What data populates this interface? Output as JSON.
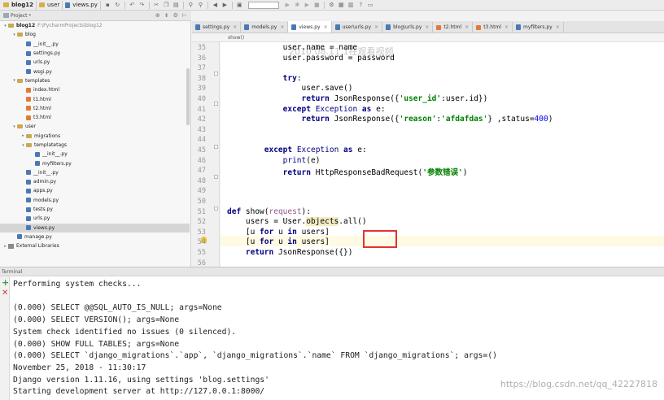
{
  "toolbar": {
    "breadcrumbs": [
      "blog12",
      "user",
      "views.py"
    ]
  },
  "project": {
    "title": "Project",
    "items": [
      {
        "label": "blog12",
        "path": "F:\\PycharmProjects\\blog12",
        "indent": 0,
        "kind": "folder",
        "arrow": "▾"
      },
      {
        "label": "blog",
        "indent": 1,
        "kind": "folder",
        "arrow": "▾"
      },
      {
        "label": "__init__.py",
        "indent": 2,
        "kind": "py"
      },
      {
        "label": "settings.py",
        "indent": 2,
        "kind": "py"
      },
      {
        "label": "urls.py",
        "indent": 2,
        "kind": "py"
      },
      {
        "label": "wsgi.py",
        "indent": 2,
        "kind": "py"
      },
      {
        "label": "templates",
        "indent": 1,
        "kind": "folder",
        "arrow": "▾"
      },
      {
        "label": "index.html",
        "indent": 2,
        "kind": "html"
      },
      {
        "label": "t1.html",
        "indent": 2,
        "kind": "html"
      },
      {
        "label": "t2.html",
        "indent": 2,
        "kind": "html"
      },
      {
        "label": "t3.html",
        "indent": 2,
        "kind": "html"
      },
      {
        "label": "user",
        "indent": 1,
        "kind": "folder",
        "arrow": "▾"
      },
      {
        "label": "migrations",
        "indent": 2,
        "kind": "folder",
        "arrow": "▸"
      },
      {
        "label": "templatetags",
        "indent": 2,
        "kind": "folder",
        "arrow": "▾"
      },
      {
        "label": "__init__.py",
        "indent": 3,
        "kind": "py"
      },
      {
        "label": "myfilters.py",
        "indent": 3,
        "kind": "py"
      },
      {
        "label": "__init__.py",
        "indent": 2,
        "kind": "py"
      },
      {
        "label": "admin.py",
        "indent": 2,
        "kind": "py"
      },
      {
        "label": "apps.py",
        "indent": 2,
        "kind": "py"
      },
      {
        "label": "models.py",
        "indent": 2,
        "kind": "py"
      },
      {
        "label": "tests.py",
        "indent": 2,
        "kind": "py"
      },
      {
        "label": "urls.py",
        "indent": 2,
        "kind": "py"
      },
      {
        "label": "views.py",
        "indent": 2,
        "kind": "py",
        "selected": true
      },
      {
        "label": "manage.py",
        "indent": 1,
        "kind": "py"
      },
      {
        "label": "External Libraries",
        "indent": 0,
        "kind": "lib",
        "arrow": "▸"
      }
    ]
  },
  "editor": {
    "tabs": [
      {
        "label": "settings.py",
        "kind": "py"
      },
      {
        "label": "models.py",
        "kind": "py"
      },
      {
        "label": "views.py",
        "kind": "py",
        "active": true
      },
      {
        "label": "user\\urls.py",
        "kind": "py"
      },
      {
        "label": "blog\\urls.py",
        "kind": "py"
      },
      {
        "label": "t2.html",
        "kind": "html"
      },
      {
        "label": "t3.html",
        "kind": "html"
      },
      {
        "label": "myfilters.py",
        "kind": "py"
      }
    ],
    "breadcrumb": "show()",
    "watermark": "2010.08.11.1在观看视频",
    "lines": [
      {
        "n": "35",
        "html": "            user.name = name"
      },
      {
        "n": "36",
        "html": "            user.password = password"
      },
      {
        "n": "37",
        "html": ""
      },
      {
        "n": "38",
        "html": "            <span class='kw'>try</span>:"
      },
      {
        "n": "39",
        "html": "                user.save()"
      },
      {
        "n": "40",
        "html": "                <span class='kw'>return</span> JsonResponse({<span class='str'>'user_id'</span>:user.id})"
      },
      {
        "n": "41",
        "html": "            <span class='kw'>except</span> <span class='cls'>Exception</span> <span class='kw'>as</span> e:"
      },
      {
        "n": "42",
        "html": "                <span class='kw'>return</span> JsonResponse({<span class='str'>'reason'</span>:<span class='str'>'afdafdas'</span>} ,status=<span class='num'>400</span>)"
      },
      {
        "n": "43",
        "html": ""
      },
      {
        "n": "44",
        "html": ""
      },
      {
        "n": "45",
        "html": "        <span class='kw'>except</span> <span class='cls'>Exception</span> <span class='kw'>as</span> e:"
      },
      {
        "n": "46",
        "html": "            <span class='cls'>print</span>(e)"
      },
      {
        "n": "47",
        "html": "            <span class='kw'>return</span> HttpResponseBadRequest(<span class='str'>'参数错误'</span>)"
      },
      {
        "n": "48",
        "html": ""
      },
      {
        "n": "49",
        "html": ""
      },
      {
        "n": "50",
        "html": ""
      },
      {
        "n": "51",
        "html": "<span class='kw'>def</span> show(<span style='color:#94558d'>request</span>):"
      },
      {
        "n": "52",
        "html": "    users = User.<span style='background:#f5ecc4'>objects</span>.all()"
      },
      {
        "n": "53",
        "html": "    [u <span class='kw'>for</span> u <span class='kw'>in</span> users]"
      },
      {
        "n": "54",
        "html": "    [u <span class='kw'>for</span> u <span class='kw'>in</span> users]"
      },
      {
        "n": "55",
        "html": "    <span class='kw'>return</span> JsonResponse({})"
      },
      {
        "n": "56",
        "html": ""
      }
    ]
  },
  "terminal": {
    "title": "Terminal",
    "lines": [
      "Performing system checks...",
      "",
      "(0.000) SELECT @@SQL_AUTO_IS_NULL; args=None",
      "(0.000) SELECT VERSION(); args=None",
      "System check identified no issues (0 silenced).",
      "(0.000) SHOW FULL TABLES; args=None",
      "(0.000) SELECT `django_migrations`.`app`, `django_migrations`.`name` FROM `django_migrations`; args=()",
      "November 25, 2018 - 11:30:17",
      "Django version 1.11.16, using settings 'blog.settings'",
      "Starting development server at http://127.0.0.1:8000/"
    ],
    "watermark": "https://blog.csdn.net/qq_42227818"
  }
}
